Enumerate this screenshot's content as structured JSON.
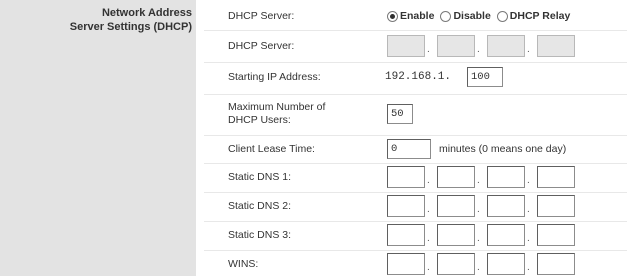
{
  "section": {
    "title_line1": "Network Address",
    "title_line2": "Server Settings (DHCP)"
  },
  "dhcp_server_mode": {
    "label": "DHCP Server:",
    "options": [
      {
        "label": "Enable",
        "selected": true
      },
      {
        "label": "Disable",
        "selected": false
      },
      {
        "label": "DHCP Relay",
        "selected": false
      }
    ]
  },
  "dhcp_server_ip": {
    "label": "DHCP Server:",
    "octets": [
      "",
      "",
      "",
      ""
    ],
    "disabled": true
  },
  "starting_ip": {
    "label": "Starting IP Address:",
    "prefix": "192.168.1.",
    "last_octet": "100"
  },
  "max_users": {
    "label_line1": "Maximum Number of",
    "label_line2": "DHCP Users:",
    "value": "50"
  },
  "lease_time": {
    "label": "Client Lease Time:",
    "value": "0",
    "hint": "minutes (0 means one day)"
  },
  "static_dns1": {
    "label": "Static DNS 1:",
    "octets": [
      "",
      "",
      "",
      ""
    ]
  },
  "static_dns2": {
    "label": "Static DNS 2:",
    "octets": [
      "",
      "",
      "",
      ""
    ]
  },
  "static_dns3": {
    "label": "Static DNS 3:",
    "octets": [
      "",
      "",
      "",
      ""
    ]
  },
  "wins": {
    "label": "WINS:",
    "octets": [
      "",
      "",
      "",
      ""
    ]
  },
  "colors": {
    "left_panel": "#e3e3e3",
    "disabled_field": "#e6e6e6",
    "text": "#333333"
  }
}
